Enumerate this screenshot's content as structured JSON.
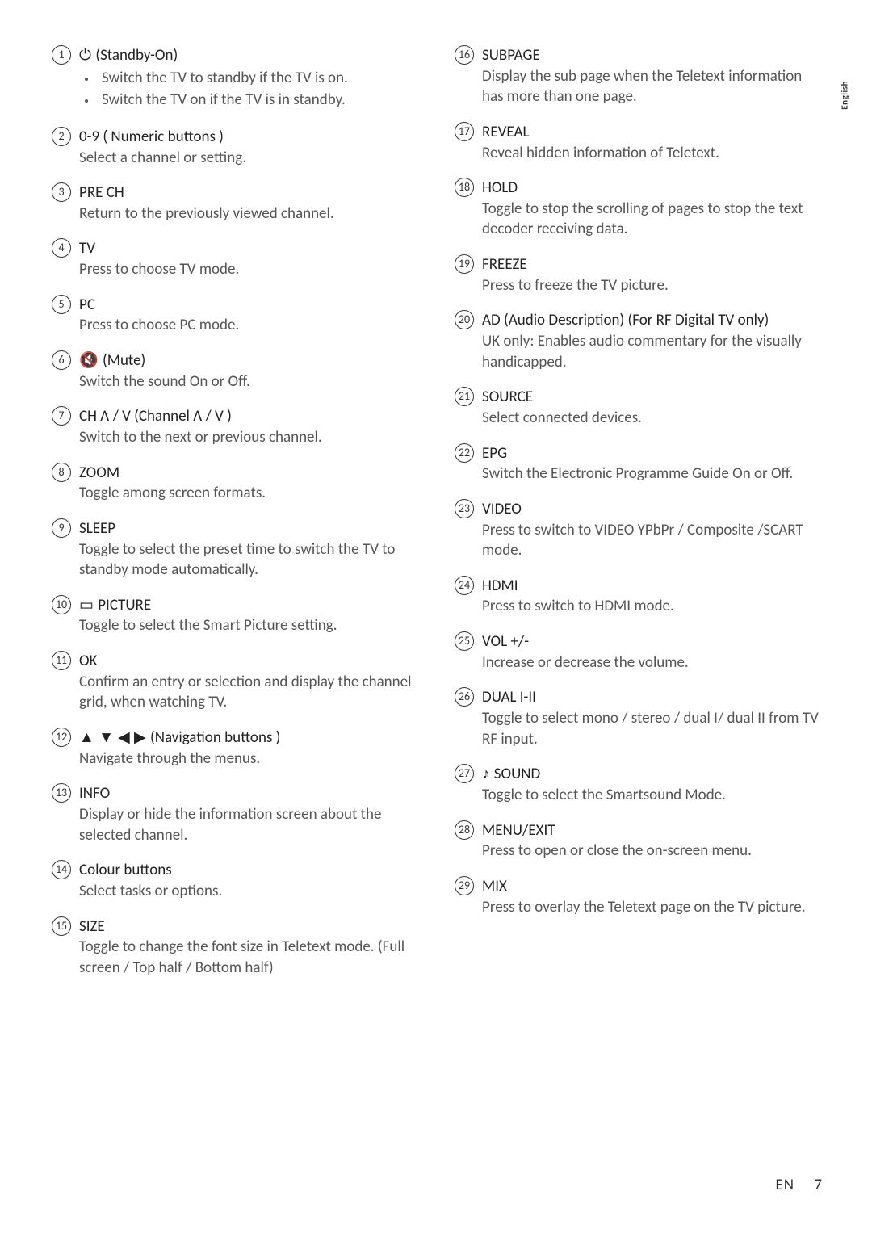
{
  "side_tab": "English",
  "footer": {
    "lang": "EN",
    "page": "7"
  },
  "left": [
    {
      "num": "1",
      "icon": "⏻",
      "title": "(Standby-On)",
      "bullets": [
        "Switch the TV to standby if the TV is on.",
        "Switch the TV on if the TV is in standby."
      ]
    },
    {
      "num": "2",
      "title": "0-9 ( Numeric buttons )",
      "desc": "Select a channel or setting."
    },
    {
      "num": "3",
      "title": "PRE CH",
      "desc": "Return to the previously viewed channel."
    },
    {
      "num": "4",
      "title": "TV",
      "desc": "Press to choose TV mode."
    },
    {
      "num": "5",
      "title": "PC",
      "desc": "Press to choose PC mode."
    },
    {
      "num": "6",
      "icon": "🔇",
      "title": "(Mute)",
      "desc": "Switch the sound On or Off."
    },
    {
      "num": "7",
      "title": "CH Λ / V (Channel Λ / V )",
      "desc": "Switch to the next or previous channel."
    },
    {
      "num": "8",
      "title": "ZOOM",
      "desc": "Toggle among screen formats."
    },
    {
      "num": "9",
      "title": "SLEEP",
      "desc": "Toggle to select the preset time to switch the TV to standby mode automatically."
    },
    {
      "num": "10",
      "icon": "▭",
      "title": "PICTURE",
      "desc": "Toggle to select the Smart Picture setting."
    },
    {
      "num": "11",
      "title": "OK",
      "desc": "Confirm an entry or selection and display the channel grid, when watching TV."
    },
    {
      "num": "12",
      "icon": "▲ ▼ ◀ ▶",
      "title": "(Navigation buttons )",
      "desc": "Navigate through the menus."
    },
    {
      "num": "13",
      "title": "INFO",
      "desc": "Display or hide the information screen about the selected channel."
    },
    {
      "num": "14",
      "title": "Colour buttons",
      "desc": "Select tasks or options."
    },
    {
      "num": "15",
      "title": "SIZE",
      "desc": "Toggle to change the font size in Teletext mode. (Full screen / Top half / Bottom half)"
    }
  ],
  "right": [
    {
      "num": "16",
      "title": "SUBPAGE",
      "desc": "Display the sub page when the Teletext information has more than one page."
    },
    {
      "num": "17",
      "title": "REVEAL",
      "desc": "Reveal hidden information of Teletext."
    },
    {
      "num": "18",
      "title": "HOLD",
      "desc": "Toggle to stop the scrolling of pages to stop the text decoder receiving data."
    },
    {
      "num": "19",
      "title": "FREEZE",
      "desc": "Press to freeze the TV picture."
    },
    {
      "num": "20",
      "title": "AD (Audio Description) (For RF Digital TV only)",
      "desc": "UK only: Enables audio commentary for the visually handicapped."
    },
    {
      "num": "21",
      "title": "SOURCE",
      "desc": "Select connected devices."
    },
    {
      "num": "22",
      "title": "EPG",
      "desc": "Switch the Electronic Programme Guide On or Off."
    },
    {
      "num": "23",
      "title": "VIDEO",
      "desc": "Press to switch to VIDEO YPbPr / Composite /SCART mode."
    },
    {
      "num": "24",
      "title": "HDMI",
      "desc": "Press to switch to HDMI mode."
    },
    {
      "num": "25",
      "title": "VOL +/-",
      "desc": "Increase or decrease the volume."
    },
    {
      "num": "26",
      "title": " DUAL I-II",
      "desc": "Toggle to select mono / stereo / dual I/ dual II from TV RF input."
    },
    {
      "num": "27",
      "icon": "♪",
      "title": "SOUND",
      "desc": "Toggle to select the Smartsound Mode."
    },
    {
      "num": "28",
      "title": "MENU/EXIT",
      "desc": "Press to open or close the on-screen menu."
    },
    {
      "num": "29",
      "title": "MIX",
      "desc": "Press to overlay the Teletext page on the TV picture."
    }
  ]
}
